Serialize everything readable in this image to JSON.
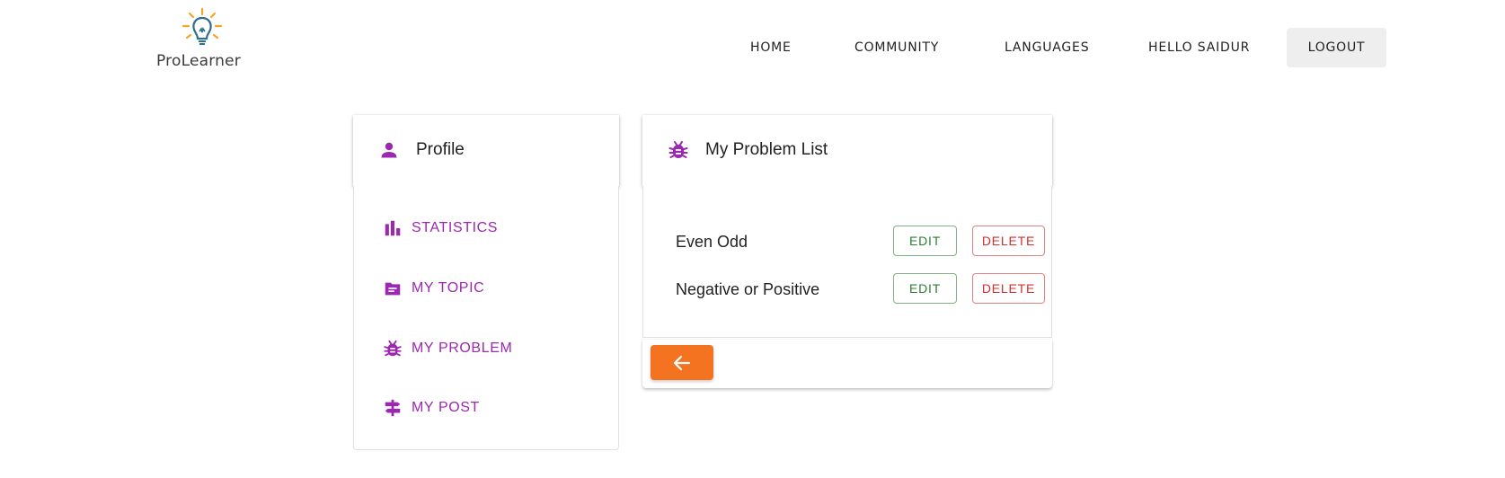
{
  "brand": {
    "name": "ProLearner"
  },
  "nav": {
    "home": "HOME",
    "community": "COMMUNITY",
    "languages": "LANGUAGES",
    "greeting": "HELLO SAIDUR",
    "logout": "LOGOUT"
  },
  "profile": {
    "title": "Profile",
    "icon": "person-icon",
    "menu": [
      {
        "label": "STATISTICS",
        "icon": "bar-chart-icon"
      },
      {
        "label": "MY TOPIC",
        "icon": "folder-icon"
      },
      {
        "label": "MY PROBLEM",
        "icon": "bug-icon"
      },
      {
        "label": "MY POST",
        "icon": "signpost-icon"
      }
    ]
  },
  "problems": {
    "title": "My Problem List",
    "icon": "bug-icon",
    "items": [
      {
        "name": "Even Odd",
        "edit": "EDIT",
        "delete": "DELETE"
      },
      {
        "name": "Negative or Positive",
        "edit": "EDIT",
        "delete": "DELETE"
      }
    ],
    "back_icon": "arrow-left-icon"
  },
  "colors": {
    "accent": "#9c27b0",
    "edit": "#2e7d32",
    "delete": "#d32f2f",
    "back_button": "#f47321",
    "logo_bulb": "#2f6f8f",
    "logo_rays": "#f5a623"
  }
}
